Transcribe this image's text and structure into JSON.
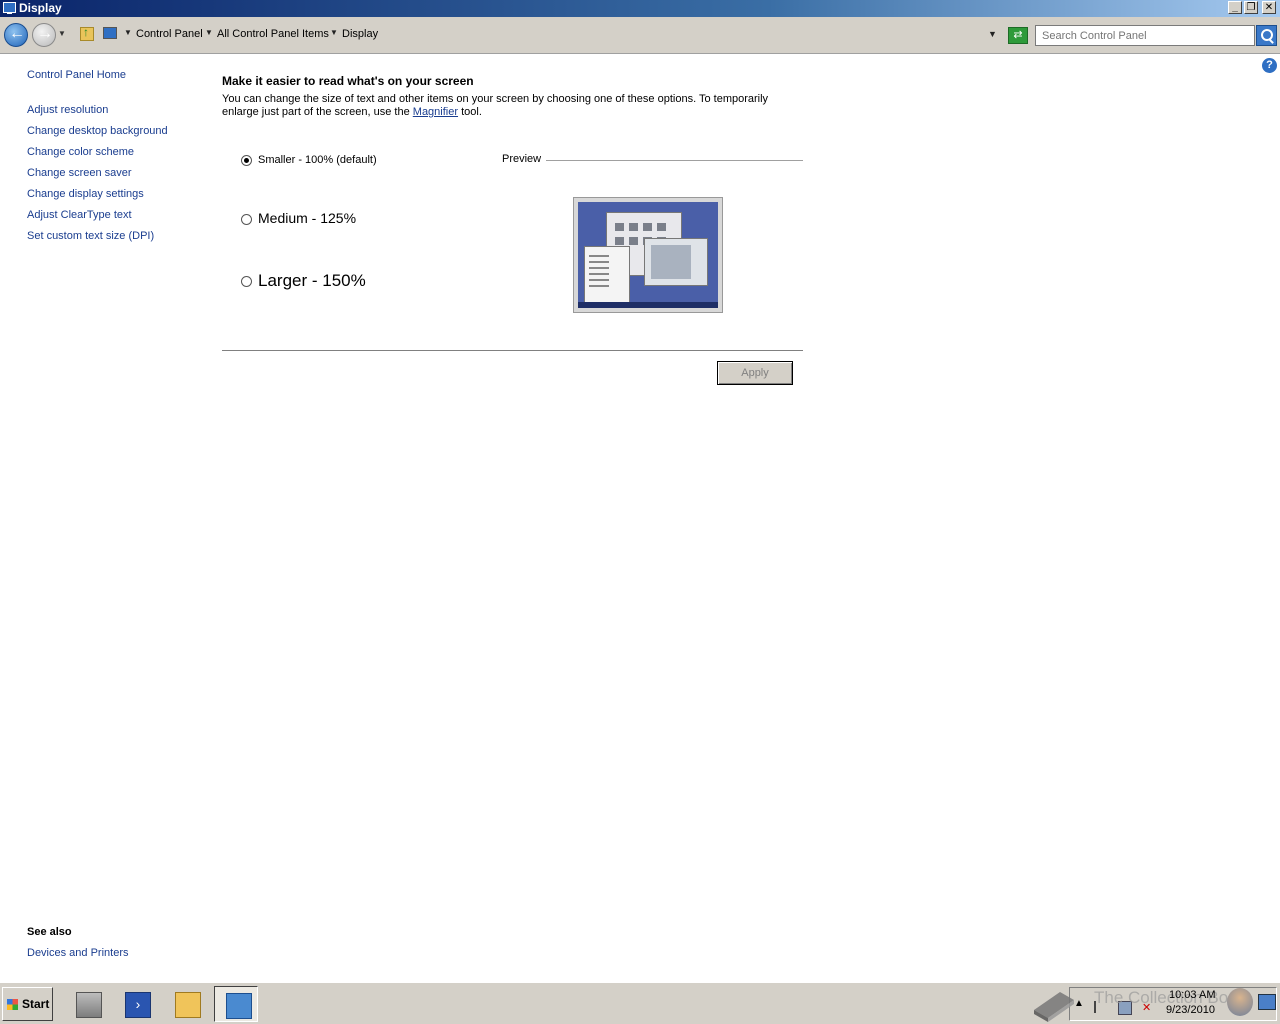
{
  "window": {
    "title": "Display"
  },
  "address": {
    "breadcrumbs": [
      "Control Panel",
      "All Control Panel Items",
      "Display"
    ],
    "search_placeholder": "Search Control Panel"
  },
  "sidebar": {
    "home": "Control Panel Home",
    "links": [
      "Adjust resolution",
      "Change desktop background",
      "Change color scheme",
      "Change screen saver",
      "Change display settings",
      "Adjust ClearType text",
      "Set custom text size (DPI)"
    ],
    "see_also_title": "See also",
    "see_also_links": [
      "Devices and Printers"
    ]
  },
  "main": {
    "heading": "Make it easier to read what's on your screen",
    "desc_before": "You can change the size of text and other items on your screen by choosing one of these options. To temporarily enlarge just part of the screen, use the ",
    "desc_link": "Magnifier",
    "desc_after": " tool.",
    "options": [
      {
        "label": "Smaller - 100% (default)",
        "checked": true
      },
      {
        "label": "Medium - 125%",
        "checked": false
      },
      {
        "label": "Larger - 150%",
        "checked": false
      }
    ],
    "preview_label": "Preview",
    "apply_label": "Apply",
    "apply_enabled": false
  },
  "taskbar": {
    "start_label": "Start",
    "apps": [
      "server-manager-icon",
      "powershell-icon",
      "windows-explorer-icon",
      "control-panel-display-icon"
    ],
    "active_app": "control-panel-display-icon",
    "clock_time": "10:03 AM",
    "clock_date": "9/23/2010",
    "watermark": "The Collection Book"
  },
  "colors": {
    "link": "#1a3d8f",
    "titlebar_start": "#0a246a",
    "chrome": "#d4d0c8"
  }
}
